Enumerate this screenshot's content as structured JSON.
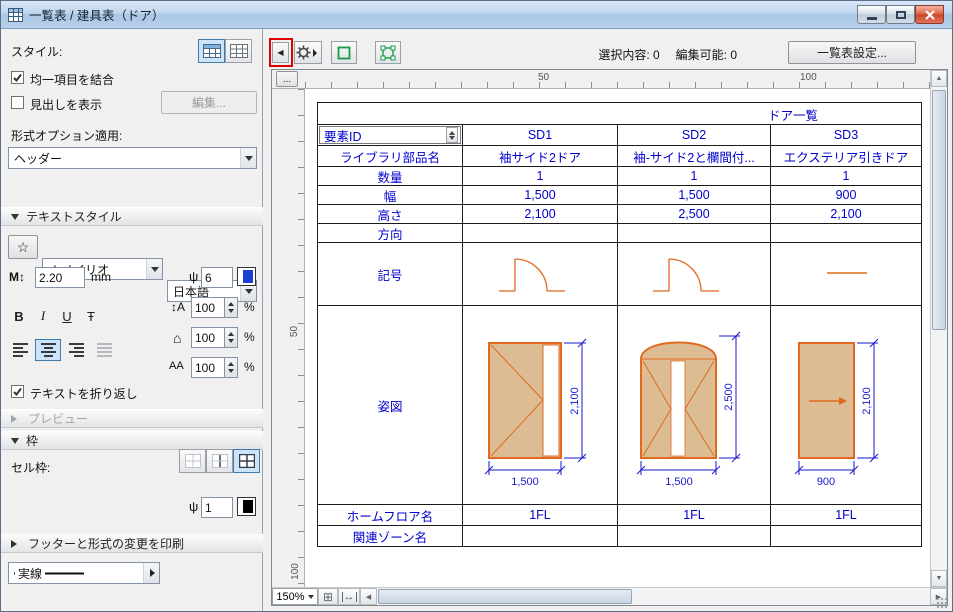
{
  "window": {
    "title": "一覧表 / 建具表（ドア）"
  },
  "sidebar": {
    "style_label": "スタイル:",
    "merge_items_label": "均一項目を結合",
    "show_headline_label": "見出しを表示",
    "edit_button": "編集...",
    "format_option_label": "形式オプション適用:",
    "format_option_value": "ヘッダー",
    "text_style_section": "テキストスタイル",
    "font_check": "✓",
    "font_value": "メイリオ",
    "language_value": "日本語",
    "text_height_value": "2.20",
    "text_height_unit": "mm",
    "text_pen_value": "6",
    "bold_label": "B",
    "italic_label": "I",
    "underline_label": "U",
    "strike_label": "Ŧ",
    "line_spacing_value": "100",
    "char_spacing_value": "100",
    "kerning_value": "100",
    "percent": "%",
    "wrap_text_label": "テキストを折り返し",
    "preview_section": "プレビュー",
    "frame_section": "枠",
    "cell_frame_label": "セル枠:",
    "line_type_value": "実線",
    "frame_pen_value": "1",
    "footer_section": "フッターと形式の変更を印刷"
  },
  "toolbar": {
    "selected_count": "選択内容: 0",
    "editable_count": "編集可能: 0",
    "settings_button": "一覧表設定..."
  },
  "rulers": {
    "h50": "50",
    "h100": "100",
    "v50": "50",
    "v100": "100"
  },
  "statusbar": {
    "zoom": "150%"
  },
  "icons": {
    "flyout_left": "◀",
    "corner_ellipsis": "...",
    "text_height": "M",
    "updown_arrow": "↕",
    "pen": "ψ",
    "star": "☆",
    "line_spacing": "A",
    "house": "⌂",
    "kerning": "AA",
    "scroll_up": "▲",
    "scroll_down": "▼",
    "scroll_left": "◀",
    "scroll_right": "▶",
    "zoom_grid": "⊞",
    "fit_width": "↔"
  },
  "colors": {
    "door_line": "#e2691f",
    "door_fill": "#dcbd93",
    "dimension": "#1a1acd",
    "table_text": "#0000cd",
    "pen6_swatch": "#1a3fd4",
    "pen1_swatch": "#000000",
    "annotation": "#dd0000"
  },
  "table": {
    "title": "ドア一覧",
    "id_header": "要素ID",
    "columns": [
      "SD1",
      "SD2",
      "SD3"
    ],
    "rows": {
      "library": {
        "label": "ライブラリ部品名",
        "values": [
          "袖サイド2ドア",
          "袖-サイド2と欄間付...",
          "エクステリア引きドア"
        ]
      },
      "quantity": {
        "label": "数量",
        "values": [
          "1",
          "1",
          "1"
        ]
      },
      "width": {
        "label": "幅",
        "values": [
          "1,500",
          "1,500",
          "900"
        ]
      },
      "height": {
        "label": "高さ",
        "values": [
          "2,100",
          "2,500",
          "2,100"
        ]
      },
      "direction": {
        "label": "方向"
      },
      "symbol": {
        "label": "記号"
      },
      "elevation": {
        "label": "姿図"
      },
      "floor": {
        "label": "ホームフロア名",
        "values": [
          "1FL",
          "1FL",
          "1FL"
        ]
      },
      "zone": {
        "label": "関連ゾーン名"
      }
    },
    "dims": {
      "sd1": {
        "w": "1,500",
        "h": "2,100"
      },
      "sd2": {
        "w": "1,500",
        "h": "2,500"
      },
      "sd3": {
        "w": "900",
        "h": "2,100"
      }
    }
  }
}
